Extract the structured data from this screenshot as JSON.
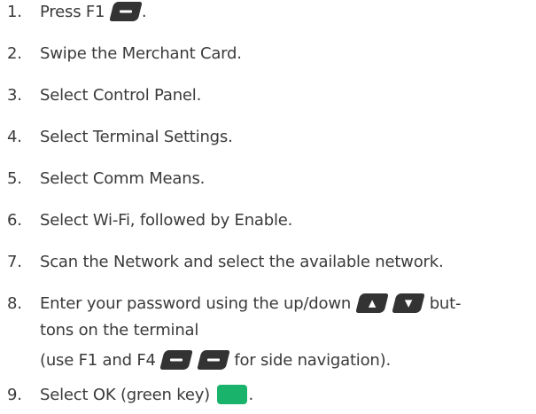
{
  "steps": [
    {
      "num": "1.",
      "text": "Press F1",
      "after": "."
    },
    {
      "num": "2.",
      "text": "Swipe the Merchant Card."
    },
    {
      "num": "3.",
      "text": "Select Control Panel."
    },
    {
      "num": "4.",
      "text": "Select Terminal Settings."
    },
    {
      "num": "5.",
      "text": "Select Comm Means."
    },
    {
      "num": "6.",
      "text": "Select Wi-Fi, followed by Enable."
    },
    {
      "num": "7.",
      "text": "Scan the Network and select the available network."
    },
    {
      "num": "8.",
      "line1_text": "Enter your password using the up/down",
      "line1_after": "but-",
      "line2_text": "tons on the terminal",
      "line3_text": "(use F1 and F4",
      "line3_after": "for side navigation)."
    },
    {
      "num": "9.",
      "text": "Select OK (green key)",
      "after": "."
    }
  ],
  "keys": {
    "f1": "dash-key-icon",
    "f4": "dash-key-icon",
    "up": "up-arrow-key-icon",
    "down": "down-arrow-key-icon",
    "ok": "green-ok-key-icon",
    "green_color": "#19b36b",
    "key_color": "#333333"
  }
}
